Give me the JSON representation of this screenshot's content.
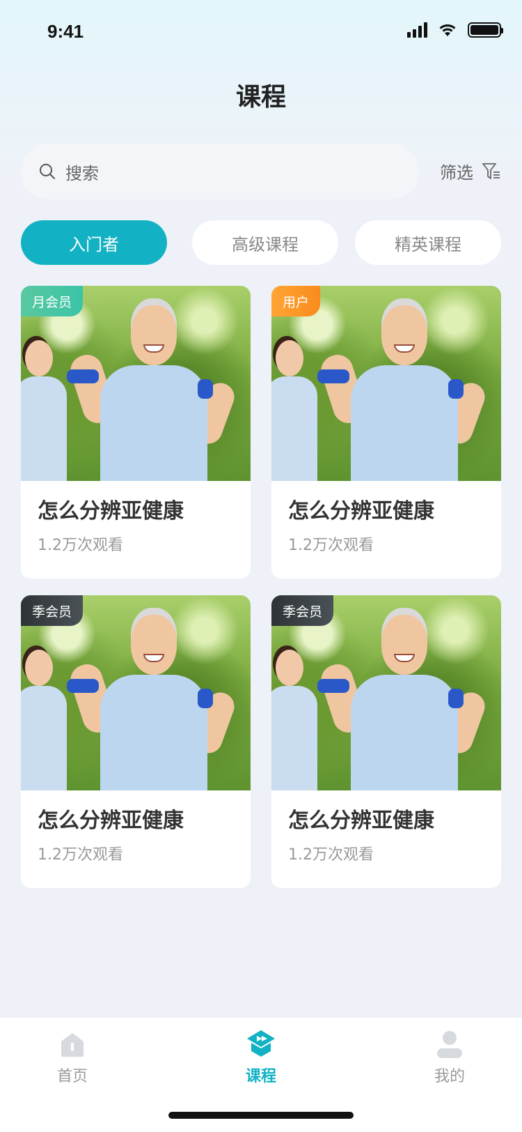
{
  "status": {
    "time": "9:41"
  },
  "header": {
    "title": "课程"
  },
  "search": {
    "placeholder": "搜索"
  },
  "filter": {
    "label": "筛选"
  },
  "tabs": [
    {
      "label": "入门者",
      "active": true
    },
    {
      "label": "高级课程",
      "active": false
    },
    {
      "label": "精英课程",
      "active": false
    }
  ],
  "cards": [
    {
      "badge": "月会员",
      "title": "怎么分辨亚健康",
      "views": "1.2万次观看"
    },
    {
      "badge": "用户",
      "title": "怎么分辨亚健康",
      "views": "1.2万次观看"
    },
    {
      "badge": "季会员",
      "title": "怎么分辨亚健康",
      "views": "1.2万次观看"
    },
    {
      "badge": "季会员",
      "title": "怎么分辨亚健康",
      "views": "1.2万次观看"
    }
  ],
  "tabbar": [
    {
      "label": "首页",
      "icon": "home-icon",
      "active": false
    },
    {
      "label": "课程",
      "icon": "course-icon",
      "active": true
    },
    {
      "label": "我的",
      "icon": "profile-icon",
      "active": false
    }
  ],
  "colors": {
    "accent": "#12b2c4",
    "badge_green": "#3bc4a8",
    "badge_orange": "#f98b1c",
    "badge_dark": "#2d3336"
  }
}
